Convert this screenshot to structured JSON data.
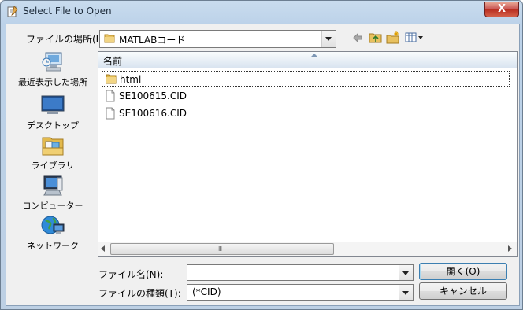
{
  "window": {
    "title": "Select File to Open",
    "close_glyph": "X"
  },
  "lookin": {
    "label": "ファイルの場所(I):",
    "value": "MATLABコード"
  },
  "toolbar_icons": [
    "back-arrow-icon",
    "up-folder-icon",
    "new-folder-icon",
    "view-menu-icon"
  ],
  "places": [
    {
      "label": "最近表示した場所",
      "icon": "recent-places-icon"
    },
    {
      "label": "デスクトップ",
      "icon": "desktop-icon"
    },
    {
      "label": "ライブラリ",
      "icon": "libraries-icon"
    },
    {
      "label": "コンピューター",
      "icon": "computer-icon"
    },
    {
      "label": "ネットワーク",
      "icon": "network-icon"
    }
  ],
  "filelist": {
    "column_name": "名前",
    "items": [
      {
        "name": "html",
        "type": "folder"
      },
      {
        "name": "SE100615.CID",
        "type": "file"
      },
      {
        "name": "SE100616.CID",
        "type": "file"
      }
    ],
    "scroll_grip": "III"
  },
  "filename": {
    "label": "ファイル名(N):",
    "value": ""
  },
  "filetype": {
    "label": "ファイルの種類(T):",
    "value": "(*CID)"
  },
  "buttons": {
    "open": "開く(O)",
    "cancel": "キャンセル"
  }
}
